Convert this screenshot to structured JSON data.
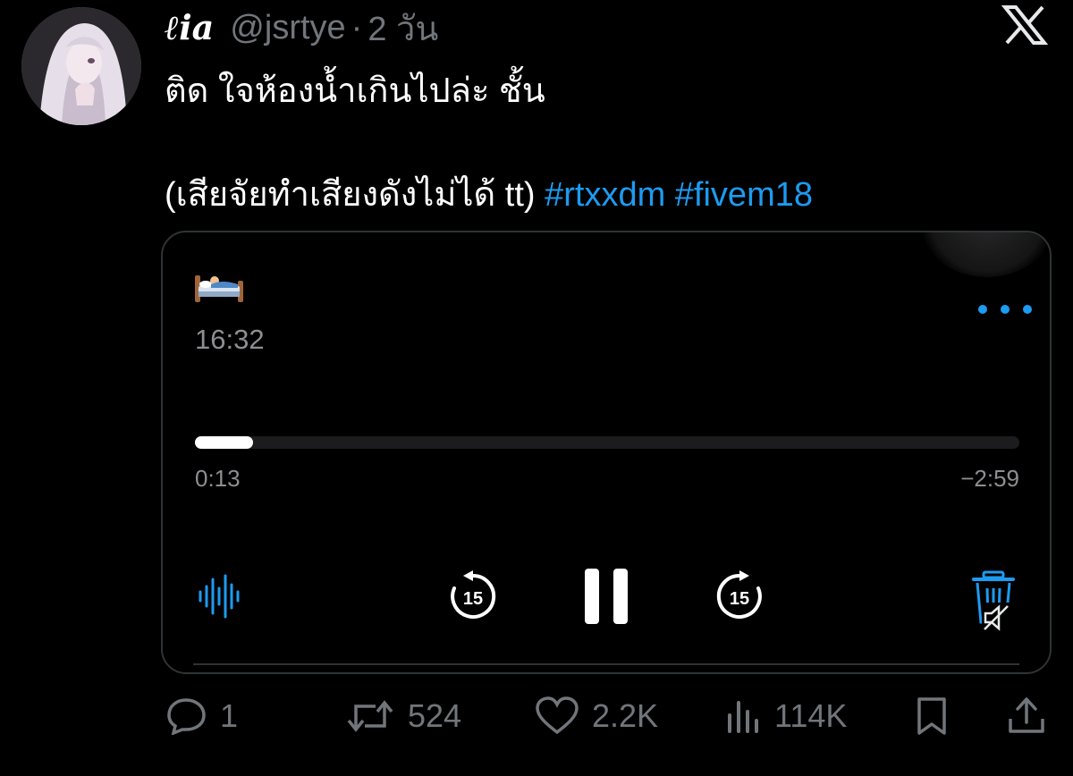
{
  "tweet": {
    "display_name": "ℓia",
    "handle": "@jsrtye",
    "separator": "·",
    "time": "2 วัน",
    "line1": "ติด ใจห้องน้ำเกินไปล่ะ ชั้น",
    "line2": "(เสียจัยทำเสียงดังไม่ได้ tt)",
    "hashtags": [
      "#rtxxdm",
      "#fivem18"
    ]
  },
  "recording": {
    "emoji": "bed-emoji",
    "title_time": "16:32",
    "elapsed": "0:13",
    "remaining": "−2:59",
    "progress": 0.07,
    "skip_back_label": "15",
    "skip_forward_label": "15"
  },
  "stats": {
    "replies": "1",
    "reposts": "524",
    "likes": "2.2K",
    "views": "114K"
  },
  "colors": {
    "accent": "#1d9bf0",
    "muted": "#71767b",
    "background": "#000000"
  },
  "icons": [
    "x-logo-icon",
    "more-icon",
    "waveform-icon",
    "skip-back-icon",
    "pause-icon",
    "skip-forward-icon",
    "trash-icon",
    "reply-icon",
    "repost-icon",
    "like-icon",
    "views-icon",
    "bookmark-icon",
    "share-icon"
  ]
}
